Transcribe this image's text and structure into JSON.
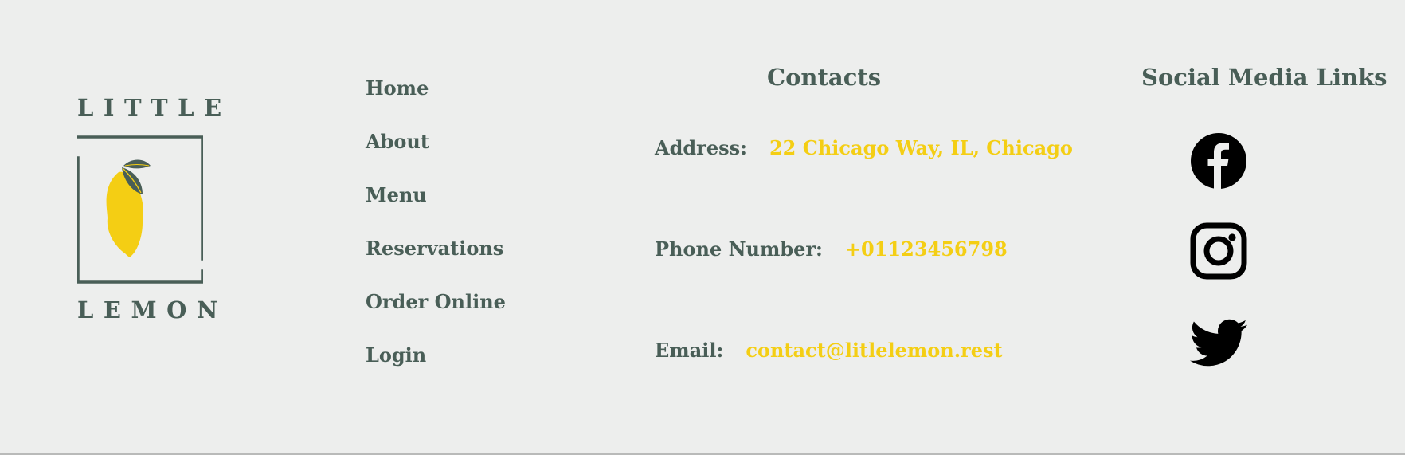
{
  "logo": {
    "top_text": "LITTLE",
    "bottom_text": "LEMON"
  },
  "nav": {
    "items": [
      {
        "label": "Home"
      },
      {
        "label": "About"
      },
      {
        "label": "Menu"
      },
      {
        "label": "Reservations"
      },
      {
        "label": "Order Online"
      },
      {
        "label": "Login"
      }
    ]
  },
  "contacts": {
    "heading": "Contacts",
    "address_label": "Address:",
    "address_value": "22 Chicago Way, IL, Chicago",
    "phone_label": "Phone Number:",
    "phone_value": "+01123456798",
    "email_label": "Email:",
    "email_value": "contact@litlelemon.rest"
  },
  "social": {
    "heading": "Social Media Links",
    "links": [
      {
        "icon": "facebook-icon"
      },
      {
        "icon": "instagram-icon"
      },
      {
        "icon": "twitter-icon"
      }
    ]
  },
  "colors": {
    "background": "#edeeed",
    "brand_green": "#495e57",
    "brand_yellow": "#f4ce14"
  }
}
